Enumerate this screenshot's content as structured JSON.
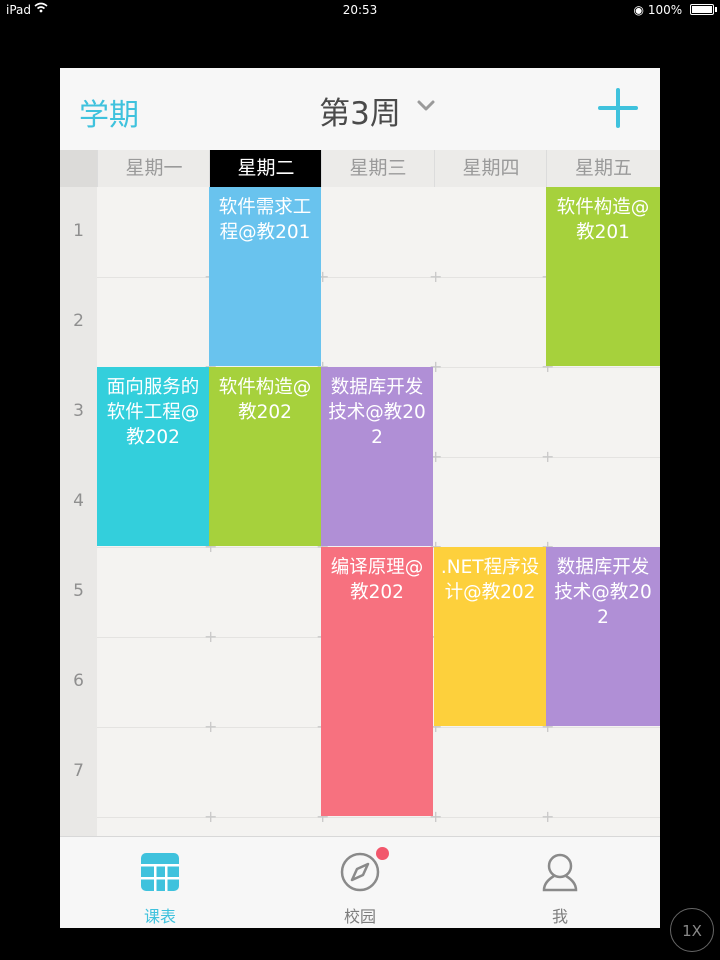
{
  "status_bar": {
    "device": "iPad",
    "time": "20:53",
    "battery": "100%"
  },
  "nav": {
    "term_label": "学期",
    "week_label": "第3周",
    "icons": [
      "chevron-down-icon",
      "plus-icon"
    ],
    "accent_color": "#3fc2dd"
  },
  "days": [
    "星期一",
    "星期二",
    "星期三",
    "星期四",
    "星期五"
  ],
  "active_day_index": 1,
  "periods": [
    "1",
    "2",
    "3",
    "4",
    "5",
    "6",
    "7"
  ],
  "courses": [
    {
      "name": "软件需求工程@教201",
      "day": 2,
      "start": 1,
      "end": 2,
      "color": "#69c3ee"
    },
    {
      "name": "软件构造@教201",
      "day": 5,
      "start": 1,
      "end": 2,
      "color": "#a6d13c"
    },
    {
      "name": "面向服务的软件工程@教202",
      "day": 1,
      "start": 3,
      "end": 4,
      "color": "#33cfdc"
    },
    {
      "name": "软件构造@教202",
      "day": 2,
      "start": 3,
      "end": 4,
      "color": "#a6d13c"
    },
    {
      "name": "数据库开发技术@教202",
      "day": 3,
      "start": 3,
      "end": 4,
      "color": "#b08fd6"
    },
    {
      "name": "编译原理@教202",
      "day": 3,
      "start": 5,
      "end": 7,
      "color": "#f7717f"
    },
    {
      "name": ".NET程序设计@教202",
      "day": 4,
      "start": 5,
      "end": 6,
      "color": "#fdd03c"
    },
    {
      "name": "数据库开发技术@教202",
      "day": 5,
      "start": 5,
      "end": 6,
      "color": "#b08fd6"
    }
  ],
  "tabs": [
    {
      "label": "课表",
      "icon": "timetable-icon",
      "active": true
    },
    {
      "label": "校园",
      "icon": "compass-icon",
      "active": false,
      "badge": true
    },
    {
      "label": "我",
      "icon": "person-icon",
      "active": false
    }
  ],
  "speed_button": "1X"
}
